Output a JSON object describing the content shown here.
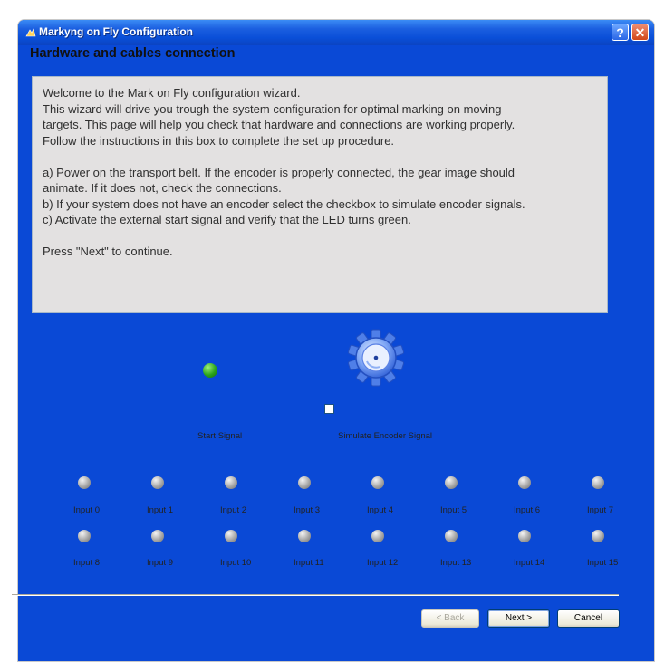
{
  "window": {
    "title": "Markyng on Fly Configuration",
    "help_label": "?",
    "close_label": "✕"
  },
  "heading": "Hardware and cables connection",
  "instructions": {
    "lines": [
      "Welcome to the Mark on Fly configuration wizard.",
      "This wizard will drive you trough the system configuration for optimal marking on moving",
      "targets. This page will help you check that hardware and connections are working properly.",
      "Follow the instructions in this box to complete the set up procedure.",
      "",
      "a) Power on the transport belt. If the encoder is properly connected, the gear image should",
      "animate. If it does not, check the connections.",
      "b) If your system does not have an encoder select the checkbox to simulate encoder signals.",
      "c) Activate the external start signal and verify that the LED turns green.",
      "",
      "Press \"Next\" to continue."
    ]
  },
  "start_signal": {
    "label": "Start Signal",
    "state": "on",
    "color": "#2aa41a"
  },
  "encoder": {
    "checkbox_label": "Simulate Encoder Signal",
    "checked": false,
    "gear_icon": "gear-icon",
    "gear_color": "#3d6fe0"
  },
  "inputs": [
    "Input 0",
    "Input 1",
    "Input 2",
    "Input 3",
    "Input 4",
    "Input 5",
    "Input 6",
    "Input 7",
    "Input 8",
    "Input 9",
    "Input 10",
    "Input 11",
    "Input 12",
    "Input 13",
    "Input 14",
    "Input 15"
  ],
  "buttons": {
    "back": "< Back",
    "next": "Next >",
    "cancel": "Cancel"
  },
  "colors": {
    "titlebar": "#0a4fd8",
    "client_bg": "#ece9d8",
    "led_off": "#a6a6a6"
  }
}
